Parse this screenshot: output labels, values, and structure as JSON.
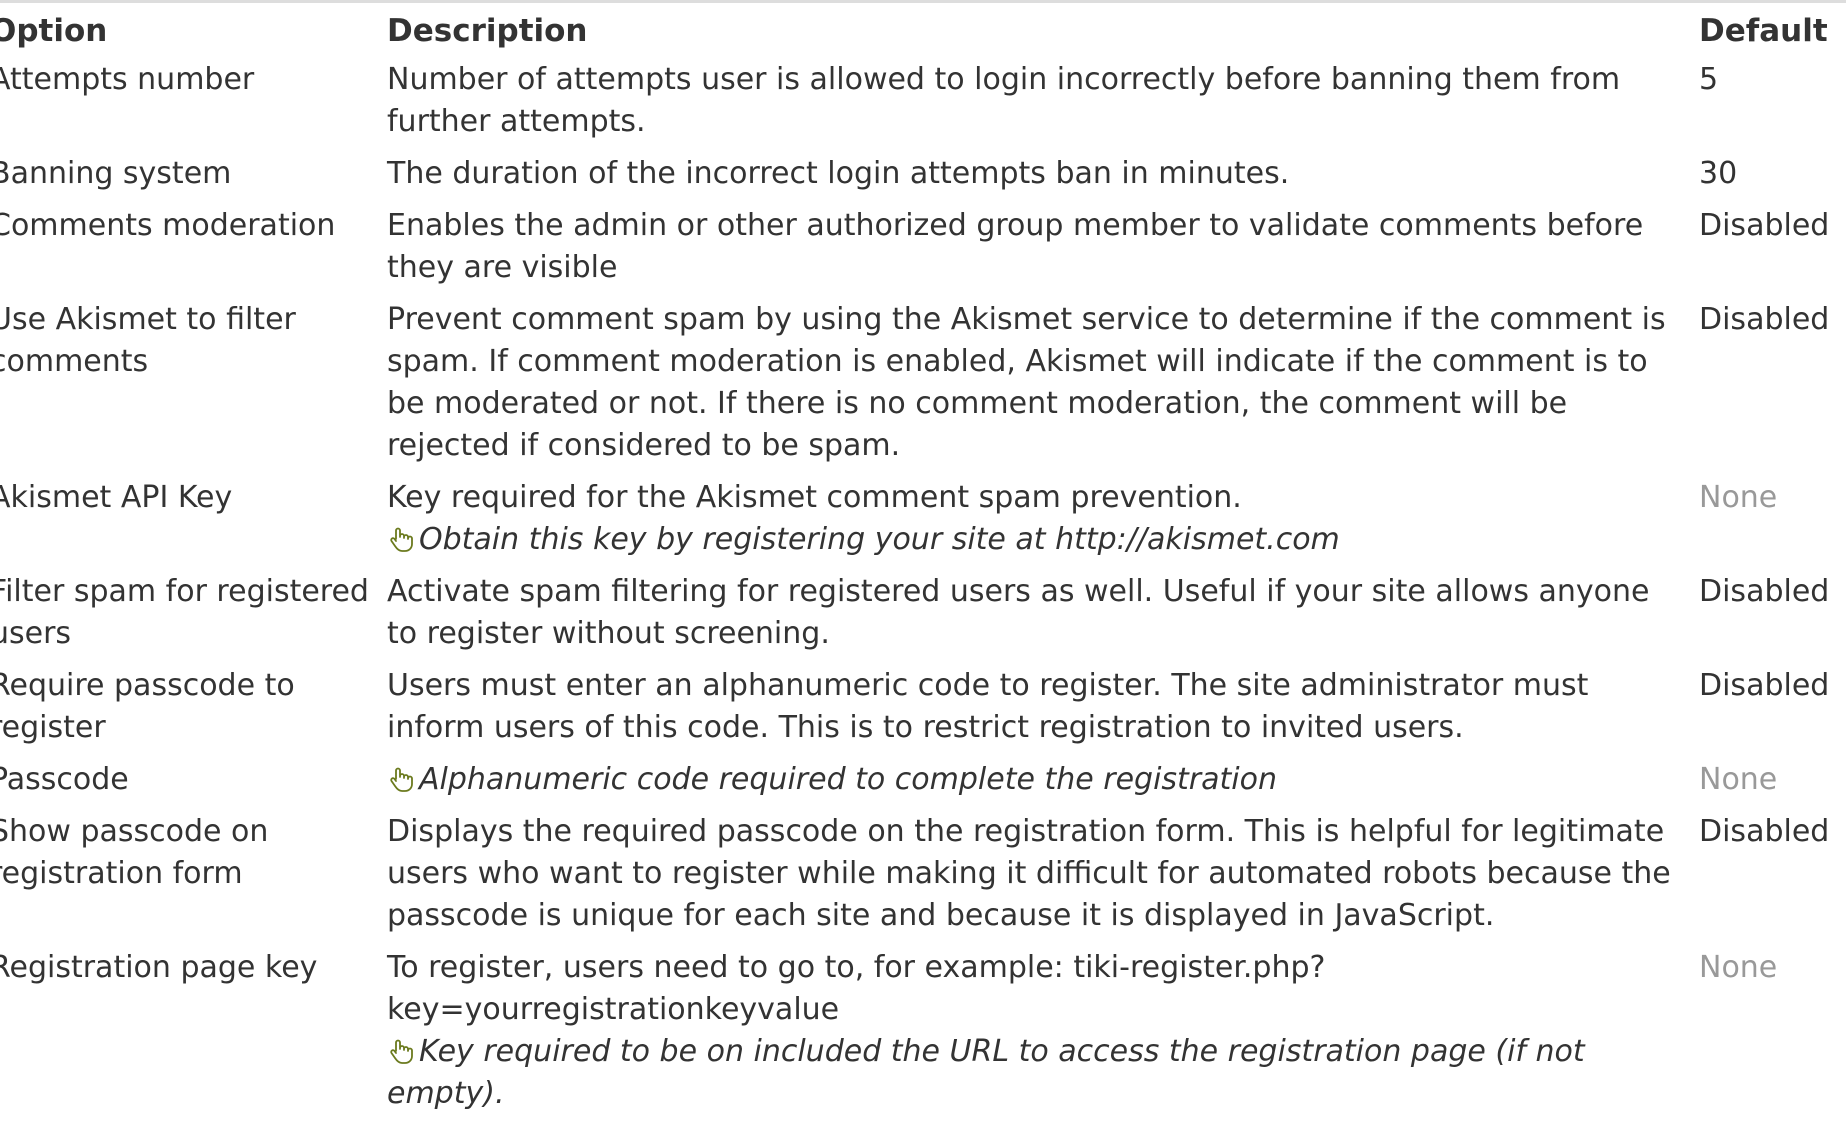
{
  "headers": {
    "option": "Option",
    "description": "Description",
    "default": "Default"
  },
  "rows": [
    {
      "option": "Attempts number",
      "description": "Number of attempts user is allowed to login incorrectly before banning them from further attempts.",
      "hint": "",
      "default": "5",
      "default_muted": false
    },
    {
      "option": "Banning system",
      "description": "The duration of the incorrect login attempts ban in minutes.",
      "hint": "",
      "default": "30",
      "default_muted": false
    },
    {
      "option": "Comments moderation",
      "description": "Enables the admin or other authorized group member to validate comments before they are visible",
      "hint": "",
      "default": "Disabled",
      "default_muted": false
    },
    {
      "option": "Use Akismet to filter comments",
      "description": "Prevent comment spam by using the Akismet service to determine if the comment is spam. If comment moderation is enabled, Akismet will indicate if the comment is to be moderated or not. If there is no comment moderation, the comment will be rejected if considered to be spam.",
      "hint": "",
      "default": "Disabled",
      "default_muted": false
    },
    {
      "option": "Akismet API Key",
      "description": "Key required for the Akismet comment spam prevention.",
      "hint": "Obtain this key by registering your site at http://akismet.com",
      "default": "None",
      "default_muted": true
    },
    {
      "option": "Filter spam for registered users",
      "description": "Activate spam filtering for registered users as well. Useful if your site allows anyone to register without screening.",
      "hint": "",
      "default": "Disabled",
      "default_muted": false
    },
    {
      "option": "Require passcode to register",
      "description": "Users must enter an alphanumeric code to register. The site administrator must inform users of this code. This is to restrict registration to invited users.",
      "hint": "",
      "default": "Disabled",
      "default_muted": false
    },
    {
      "option": "Passcode",
      "description": "",
      "hint": "Alphanumeric code required to complete the registration",
      "default": "None",
      "default_muted": true
    },
    {
      "option": "Show passcode on registration form",
      "description": "Displays the required passcode on the registration form. This is helpful for legitimate users who want to register while making it difficult for automated robots because the passcode is unique for each site and because it is displayed in JavaScript.",
      "hint": "",
      "default": "Disabled",
      "default_muted": false
    },
    {
      "option": "Registration page key",
      "description": "To register, users need to go to, for example: tiki-register.php?key=yourregistrationkeyvalue",
      "hint": "Key required to be on included the URL to access the registration page (if not empty).",
      "default": "None",
      "default_muted": true
    }
  ],
  "colors": {
    "text": "#333333",
    "muted": "#999999",
    "icon": "#6b7a1e"
  },
  "icons": {
    "hint": "hand-pointer-icon"
  }
}
